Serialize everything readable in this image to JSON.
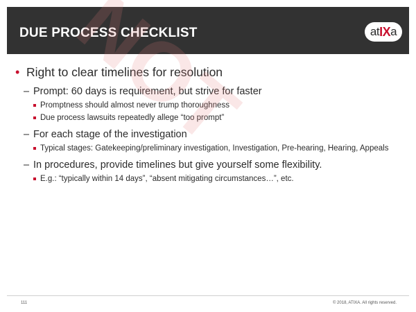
{
  "header": {
    "title": "DUE PROCESS CHECKLIST",
    "logo_text": "atixa"
  },
  "watermark": "NOT",
  "content": {
    "bullet1": "Right to clear timelines for resolution",
    "sub1": "Prompt: 60 days is requirement, but strive for faster",
    "sub1_items": [
      "Promptness should almost never trump thoroughness",
      "Due process lawsuits repeatedly allege “too prompt”"
    ],
    "sub2": "For each stage of the investigation",
    "sub2_items": [
      "Typical stages: Gatekeeping/preliminary investigation, Investigation, Pre-hearing, Hearing, Appeals"
    ],
    "sub3": "In procedures, provide timelines but give yourself some flexibility.",
    "sub3_items": [
      "E.g.: “typically within 14 days”, “absent mitigating circumstances…”, etc."
    ]
  },
  "footer": {
    "page_number": "111",
    "copyright": "© 2018, ATIXA. All rights reserved."
  },
  "colors": {
    "header_bg": "#323232",
    "accent": "#c8102e"
  }
}
